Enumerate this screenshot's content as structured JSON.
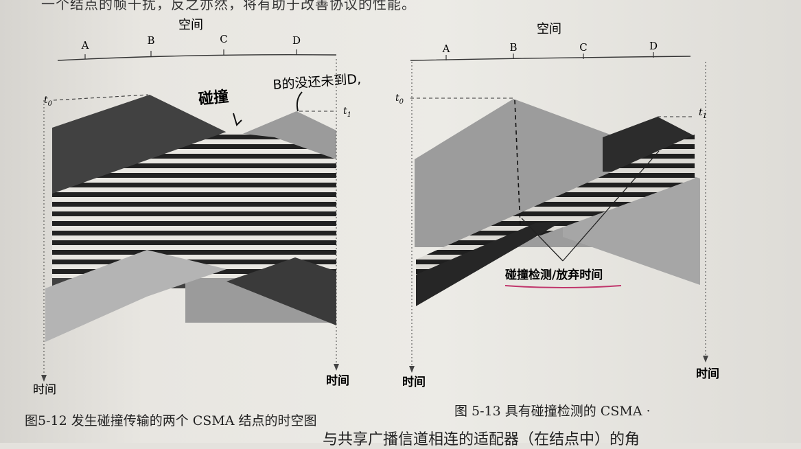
{
  "page": {
    "top_text": "一个结点的帧干扰，反之亦然，将有助于改善协议的性能。",
    "bottom_text": "与共享广播信道相连的适配器（在结点中）的角"
  },
  "figure_left": {
    "space_label": "空间",
    "nodes": [
      "A",
      "B",
      "C",
      "D"
    ],
    "t0_label": "t0",
    "t1_label": "t1",
    "time_label_left": "时间",
    "time_label_right": "时间",
    "handwritten_collision": "碰撞",
    "handwritten_note": "B的没还未到D,",
    "caption": "图5-12   发生碰撞传输的两个 CSMA 结点的时空图"
  },
  "figure_right": {
    "space_label": "空间",
    "nodes": [
      "A",
      "B",
      "C",
      "D"
    ],
    "t0_label": "t0",
    "t1_label": "t1",
    "time_label_left": "时间",
    "time_label_right": "时间",
    "annotation": "碰撞检测/放弃时间",
    "caption": "图 5-13   具有碰撞检测的 CSMA ·"
  },
  "colors": {
    "paper": "#e4e2dd",
    "dark_gray": "#3e3e3e",
    "mid_gray": "#9a9a9a",
    "light_gray": "#b5b5b5",
    "stripe": "#232323",
    "underline": "#c0356b"
  }
}
